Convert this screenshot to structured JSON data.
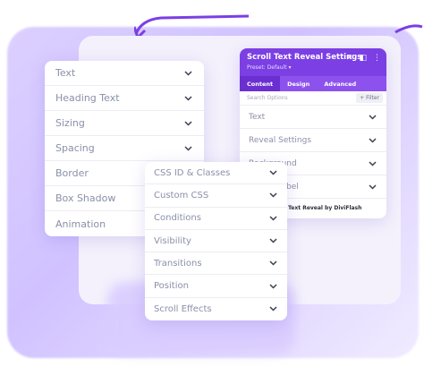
{
  "left_panel": {
    "items": [
      {
        "label": "Text"
      },
      {
        "label": "Heading Text"
      },
      {
        "label": "Sizing"
      },
      {
        "label": "Spacing"
      },
      {
        "label": "Border"
      },
      {
        "label": "Box Shadow"
      },
      {
        "label": "Animation"
      }
    ]
  },
  "middle_panel": {
    "items": [
      {
        "label": "CSS ID & Classes"
      },
      {
        "label": "Custom CSS"
      },
      {
        "label": "Conditions"
      },
      {
        "label": "Visibility"
      },
      {
        "label": "Transitions"
      },
      {
        "label": "Position"
      },
      {
        "label": "Scroll Effects"
      }
    ]
  },
  "settings_panel": {
    "title": "Scroll Text Reveal Settings",
    "preset": "Preset: Default ▾",
    "tabs": [
      "Content",
      "Design",
      "Advanced"
    ],
    "active_tab": "Content",
    "search_placeholder": "Search Options",
    "filter_label": "+ Filter",
    "items": [
      {
        "label": "Text"
      },
      {
        "label": "Reveal Settings"
      },
      {
        "label": "Background"
      },
      {
        "label": "Admin Label"
      }
    ],
    "footer": "Text Reveal by DiviFlash"
  },
  "colors": {
    "header": "#7b3fe4",
    "tabs_bar": "#8d52ee",
    "active_tab": "#6b2fd1",
    "row_text": "#8a90a8"
  }
}
